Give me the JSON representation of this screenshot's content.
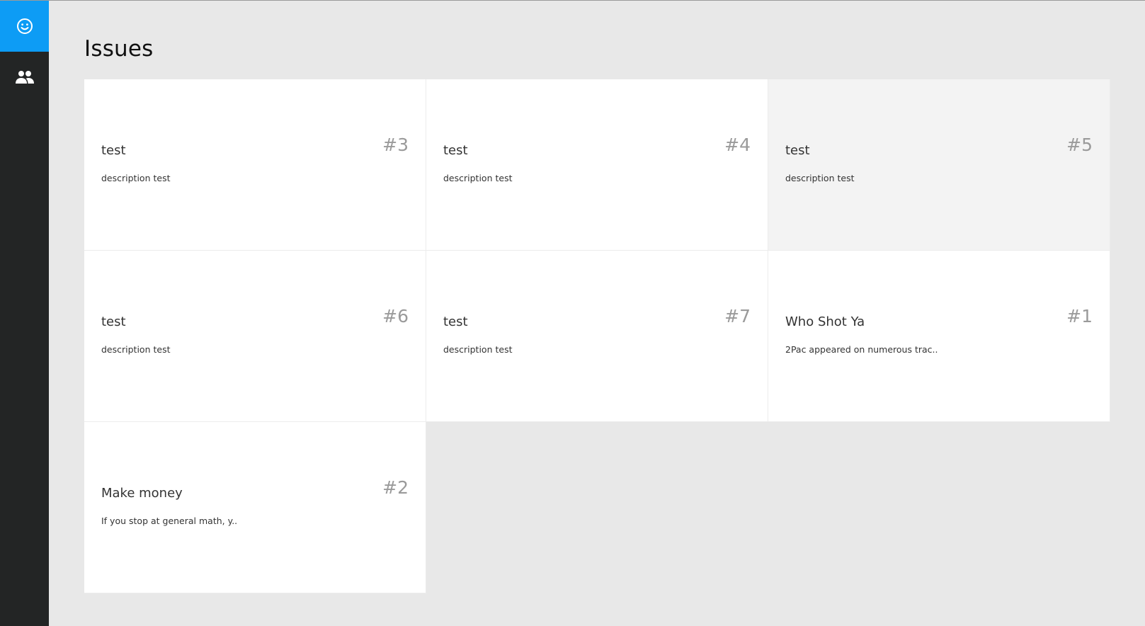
{
  "sidebar": {
    "items": [
      {
        "icon": "smiley-icon",
        "active": true
      },
      {
        "icon": "people-icon",
        "active": false
      }
    ]
  },
  "colors": {
    "sidebar_bg": "#232525",
    "accent": "#0d9cf5",
    "page_bg": "#e8e8e8",
    "card_bg": "#ffffff",
    "card_hover_bg": "#f3f3f3",
    "number_color": "#9a9a9a"
  },
  "page": {
    "title": "Issues"
  },
  "issues": [
    {
      "title": "test",
      "number": "#3",
      "description": "description test"
    },
    {
      "title": "test",
      "number": "#4",
      "description": "description test"
    },
    {
      "title": "test",
      "number": "#5",
      "description": "description test",
      "hovered": true
    },
    {
      "title": "test",
      "number": "#6",
      "description": "description test"
    },
    {
      "title": "test",
      "number": "#7",
      "description": "description test"
    },
    {
      "title": "Who Shot Ya",
      "number": "#1",
      "description": "2Pac appeared on numerous trac.."
    },
    {
      "title": "Make money",
      "number": "#2",
      "description": "If you stop at general math, y.."
    }
  ]
}
